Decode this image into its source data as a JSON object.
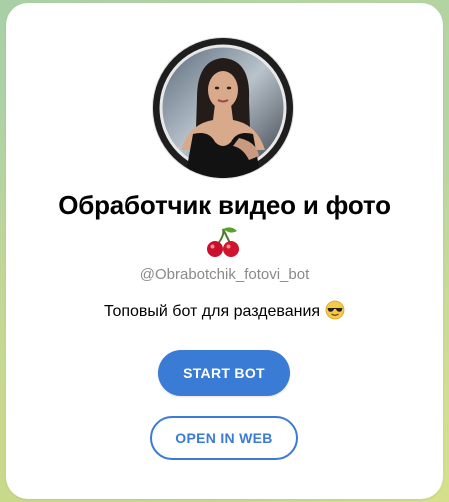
{
  "bot": {
    "name": "Обработчик видео и фото",
    "name_emoji_icon": "cherries-icon",
    "username": "@Obrabotchik_fotovi_bot",
    "description": "Топовый бот для раздевания",
    "description_emoji_icon": "smiling-face-with-sunglasses-icon"
  },
  "buttons": {
    "start_label": "START BOT",
    "web_label": "OPEN IN WEB"
  },
  "colors": {
    "accent": "#3a7bd5",
    "card_background": "#ffffff",
    "username_gray": "#8a8a8a"
  }
}
